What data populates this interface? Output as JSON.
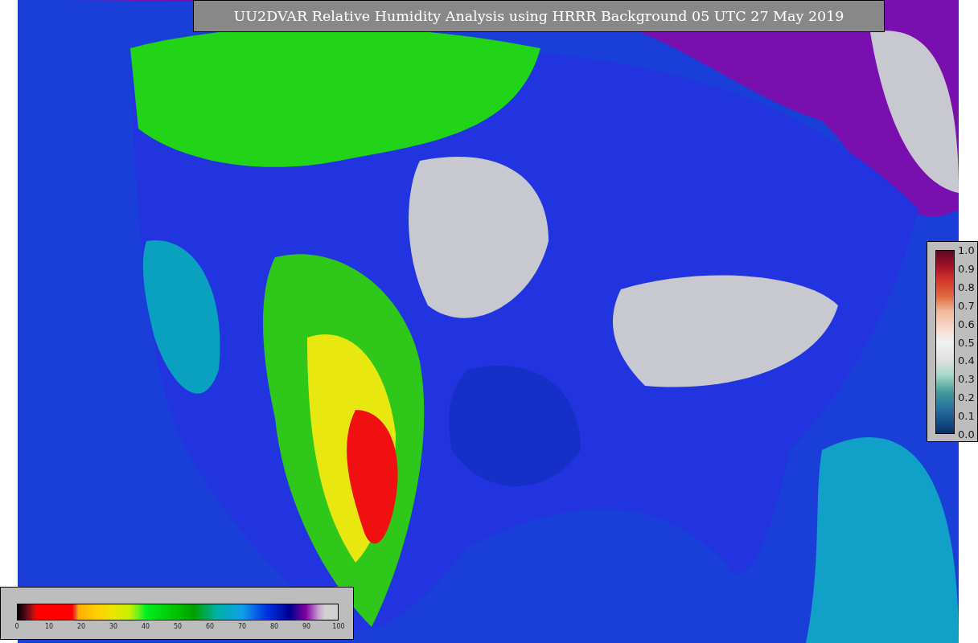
{
  "title": "UU2DVAR Relative Humidity Analysis using HRRR Background 05 UTC 27 May 2019",
  "humidity_colorbar": {
    "ticks": [
      "0",
      "10",
      "20",
      "30",
      "40",
      "50",
      "60",
      "70",
      "80",
      "90",
      "100"
    ]
  },
  "ratio_colorbar": {
    "ticks": [
      "1.0",
      "0.9",
      "0.8",
      "0.7",
      "0.6",
      "0.5",
      "0.4",
      "0.3",
      "0.2",
      "0.1",
      "0.0"
    ]
  }
}
